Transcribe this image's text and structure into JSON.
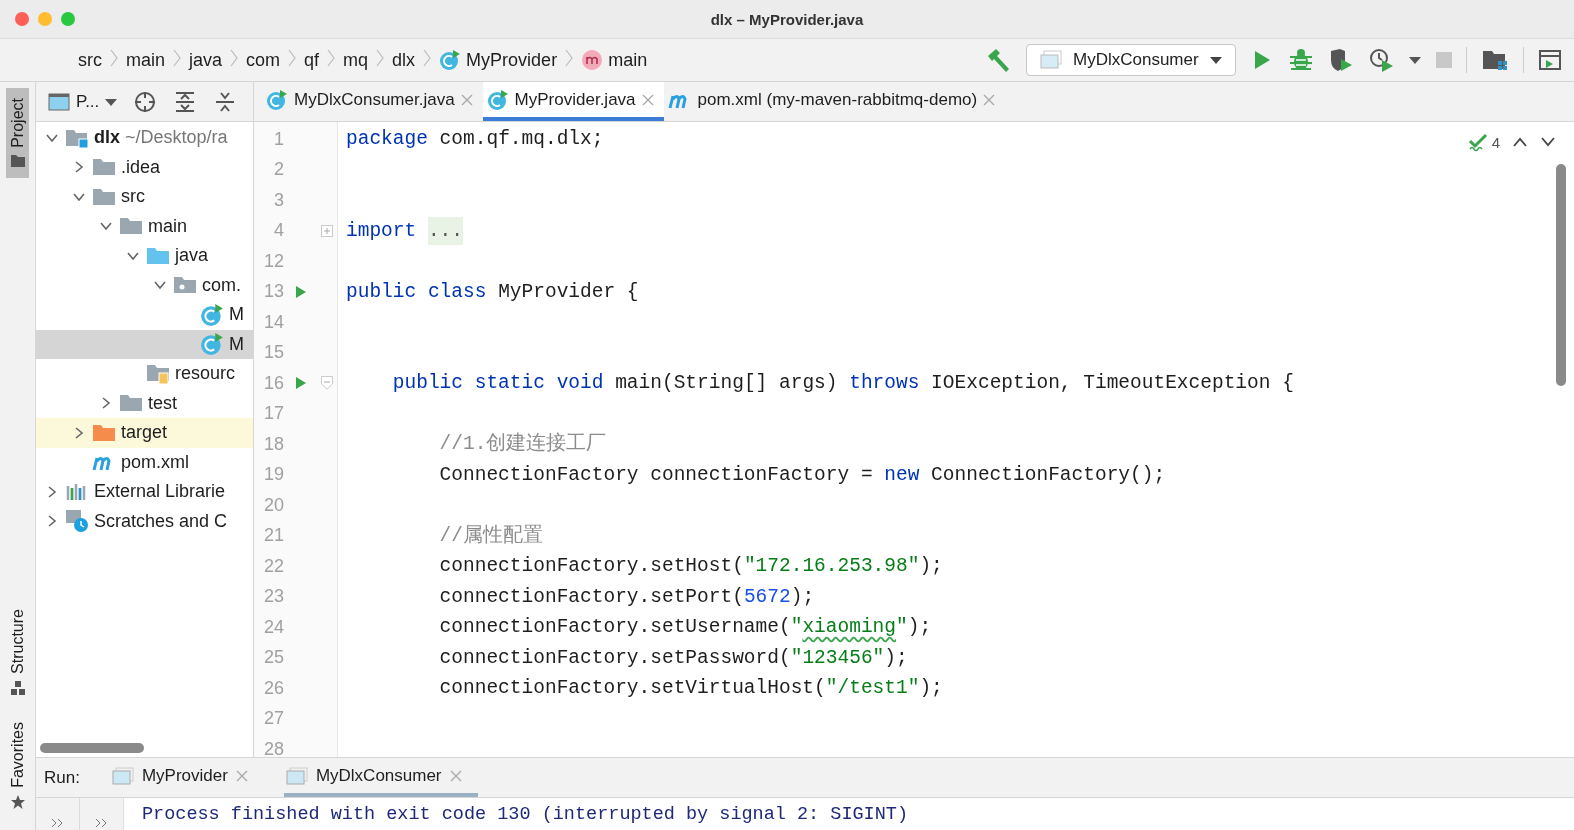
{
  "window": {
    "title": "dlx – MyProvider.java"
  },
  "breadcrumbs": [
    {
      "label": "src",
      "kind": "plain"
    },
    {
      "label": "main",
      "kind": "plain"
    },
    {
      "label": "java",
      "kind": "plain"
    },
    {
      "label": "com",
      "kind": "plain"
    },
    {
      "label": "qf",
      "kind": "plain"
    },
    {
      "label": "mq",
      "kind": "plain"
    },
    {
      "label": "dlx",
      "kind": "plain"
    },
    {
      "label": "MyProvider",
      "kind": "class"
    },
    {
      "label": "main",
      "kind": "method"
    }
  ],
  "toolbar": {
    "run_config": "MyDlxConsumer",
    "stop_disabled": true
  },
  "side_tabs": {
    "top": [
      {
        "label": "Project",
        "selected": true
      }
    ],
    "bottom": [
      {
        "label": "Structure",
        "selected": false
      },
      {
        "label": "Favorites",
        "selected": false
      }
    ]
  },
  "project": {
    "view": "P...",
    "tree": [
      {
        "label": "dlx",
        "suffix": "~/Desktop/ra",
        "kind": "module",
        "expanded": true,
        "selected": false,
        "highlighted": false,
        "children": [
          {
            "label": ".idea",
            "kind": "folder",
            "expanded": false,
            "selected": false,
            "highlighted": false
          },
          {
            "label": "src",
            "kind": "folder",
            "expanded": true,
            "selected": false,
            "highlighted": false,
            "children": [
              {
                "label": "main",
                "kind": "folder",
                "expanded": true,
                "selected": false,
                "highlighted": false,
                "children": [
                  {
                    "label": "java",
                    "kind": "source",
                    "expanded": true,
                    "selected": false,
                    "highlighted": false,
                    "children": [
                      {
                        "label": "com.",
                        "kind": "package",
                        "expanded": true,
                        "selected": false,
                        "highlighted": false,
                        "children": [
                          {
                            "label": "M",
                            "kind": "class",
                            "selected": false,
                            "highlighted": false
                          },
                          {
                            "label": "M",
                            "kind": "class",
                            "selected": true,
                            "highlighted": false
                          }
                        ]
                      }
                    ]
                  },
                  {
                    "label": "resourc",
                    "kind": "resources",
                    "selected": false,
                    "highlighted": false
                  }
                ]
              },
              {
                "label": "test",
                "kind": "folder",
                "expanded": false,
                "selected": false,
                "highlighted": false
              }
            ]
          },
          {
            "label": "target",
            "kind": "excluded",
            "expanded": false,
            "selected": false,
            "highlighted": true
          },
          {
            "label": "pom.xml",
            "kind": "maven",
            "selected": false,
            "highlighted": false
          }
        ]
      },
      {
        "label": "External Librarie",
        "kind": "libraries",
        "expanded": false,
        "selected": false,
        "highlighted": false
      },
      {
        "label": "Scratches and C",
        "kind": "scratches",
        "expanded": false,
        "selected": false,
        "highlighted": false
      }
    ]
  },
  "editor_tabs": [
    {
      "label": "MyDlxConsumer.java",
      "kind": "class",
      "selected": false
    },
    {
      "label": "MyProvider.java",
      "kind": "class",
      "selected": true
    },
    {
      "label": "pom.xml (my-maven-rabbitmq-demo)",
      "kind": "maven",
      "selected": false
    }
  ],
  "editor": {
    "inspections": "4",
    "lines": [
      {
        "number": "1",
        "run": false,
        "tokens": [
          {
            "kind": "kw",
            "text": "package"
          },
          {
            "kind": "plain",
            "text": " com.qf.mq.dlx;"
          }
        ]
      },
      {
        "number": "2",
        "run": false
      },
      {
        "number": "3",
        "run": false
      },
      {
        "number": "4",
        "run": false,
        "folded": true,
        "tokens": [
          {
            "kind": "kw",
            "text": "import "
          },
          {
            "kind": "folded",
            "text": "..."
          }
        ]
      },
      {
        "number": "12",
        "run": false
      },
      {
        "number": "13",
        "run": true,
        "tokens": [
          {
            "kind": "kw",
            "text": "public class"
          },
          {
            "kind": "plain",
            "text": " MyProvider {"
          }
        ]
      },
      {
        "number": "14",
        "run": false
      },
      {
        "number": "15",
        "run": false
      },
      {
        "number": "16",
        "run": true,
        "folded": false,
        "tokens": [
          {
            "kind": "kw",
            "text": "    public static void"
          },
          {
            "kind": "plain",
            "text": " main(String[] args) "
          },
          {
            "kind": "kw",
            "text": "throws"
          },
          {
            "kind": "plain",
            "text": " IOException, TimeoutException {"
          }
        ]
      },
      {
        "number": "17",
        "run": false
      },
      {
        "number": "18",
        "run": false,
        "tokens": [
          {
            "kind": "comment",
            "text": "        //1.创建连接工厂"
          }
        ]
      },
      {
        "number": "19",
        "run": false,
        "tokens": [
          {
            "kind": "plain",
            "text": "        ConnectionFactory connectionFactory = "
          },
          {
            "kind": "kw",
            "text": "new"
          },
          {
            "kind": "plain",
            "text": " ConnectionFactory();"
          }
        ]
      },
      {
        "number": "20",
        "run": false
      },
      {
        "number": "21",
        "run": false,
        "tokens": [
          {
            "kind": "comment",
            "text": "        //属性配置"
          }
        ]
      },
      {
        "number": "22",
        "run": false,
        "tokens": [
          {
            "kind": "plain",
            "text": "        connectionFactory.setHost("
          },
          {
            "kind": "str",
            "text": "\"172.16.253.98\""
          },
          {
            "kind": "plain",
            "text": ");"
          }
        ]
      },
      {
        "number": "23",
        "run": false,
        "tokens": [
          {
            "kind": "plain",
            "text": "        connectionFactory.setPort("
          },
          {
            "kind": "num",
            "text": "5672"
          },
          {
            "kind": "plain",
            "text": ");"
          }
        ]
      },
      {
        "number": "24",
        "run": false,
        "tokens": [
          {
            "kind": "plain",
            "text": "        connectionFactory.setUsername("
          },
          {
            "kind": "str",
            "text": "\""
          },
          {
            "kind": "typo",
            "text": "xiaoming"
          },
          {
            "kind": "str",
            "text": "\""
          },
          {
            "kind": "plain",
            "text": ");"
          }
        ]
      },
      {
        "number": "25",
        "run": false,
        "tokens": [
          {
            "kind": "plain",
            "text": "        connectionFactory.setPassword("
          },
          {
            "kind": "str",
            "text": "\"123456\""
          },
          {
            "kind": "plain",
            "text": ");"
          }
        ]
      },
      {
        "number": "26",
        "run": false,
        "tokens": [
          {
            "kind": "plain",
            "text": "        connectionFactory.setVirtualHost("
          },
          {
            "kind": "str",
            "text": "\"/test1\""
          },
          {
            "kind": "plain",
            "text": ");"
          }
        ]
      },
      {
        "number": "27",
        "run": false
      },
      {
        "number": "28",
        "run": false
      }
    ]
  },
  "run": {
    "label": "Run:",
    "tabs": [
      {
        "label": "MyProvider",
        "selected": false
      },
      {
        "label": "MyDlxConsumer",
        "selected": true
      }
    ],
    "output": "Process finished with exit code 130 (interrupted by signal 2: SIGINT)"
  }
}
